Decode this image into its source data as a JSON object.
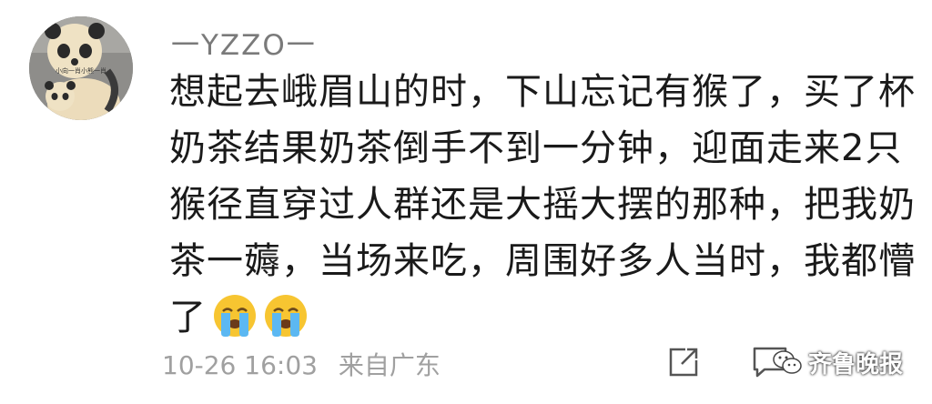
{
  "post": {
    "username": "一YZZO一",
    "avatar_caption": "小向一肖小熊一肖",
    "comment_lines": [
      "想起去峨眉山的时，下山忘记有猴了，买了杯",
      "奶茶结果奶茶倒手不到一分钟，迎面走来2只",
      "猴径直穿过人群还是大摇大摆的那种，把我奶",
      "茶一薅，当场来吃，周围好多人当时，我都懵",
      "了"
    ],
    "emojis": [
      "crying-face-emoji",
      "crying-face-emoji"
    ],
    "timestamp": "10-26 16:03",
    "location": "来自广东"
  },
  "actions": {
    "share_icon": "share-icon",
    "comment_icon": "comment-icon"
  },
  "watermark": {
    "text": "齐鲁晚报",
    "icon": "wechat-icon"
  },
  "colors": {
    "text_primary": "#1a1a1a",
    "text_secondary": "#a0a0a0",
    "username": "#7a7a7a",
    "background": "#ffffff"
  }
}
